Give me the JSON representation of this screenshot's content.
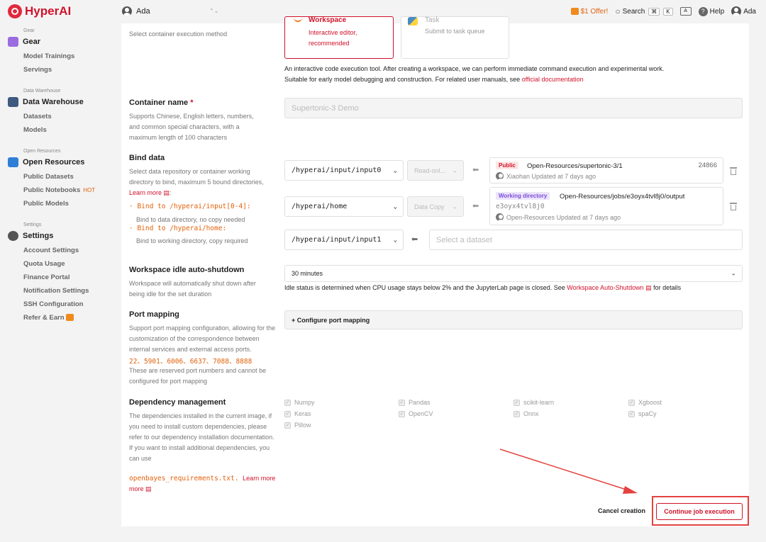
{
  "topbar": {
    "brand": "HyperAI",
    "user": "Ada",
    "offer": "$1 Offer!",
    "search": "Search",
    "kbd_cmd": "⌘",
    "kbd_k": "K",
    "help": "Help",
    "account": "Ada"
  },
  "sidebar": {
    "gear_small": "Gear",
    "gear_title": "Gear",
    "gear_items": [
      "Model Trainings",
      "Servings"
    ],
    "dw_small": "Data Warehouse",
    "dw_title": "Data Warehouse",
    "dw_items": [
      "Datasets",
      "Models"
    ],
    "or_small": "Open Resources",
    "or_title": "Open Resources",
    "or_items": [
      "Public Datasets",
      "Public Notebooks",
      "Public Models"
    ],
    "hot_badge": "HOT",
    "set_small": "Settings",
    "set_title": "Settings",
    "set_items": [
      "Account Settings",
      "Quota Usage",
      "Finance Portal",
      "Notification Settings",
      "SSH Configuration",
      "Refer & Earn"
    ]
  },
  "form": {
    "exec_desc": "Select container execution method",
    "workspace_title": "Workspace",
    "workspace_desc": "Interactive editor, recommended",
    "task_title": "Task",
    "task_desc": "Submit to task queue",
    "exec_info_1": "An interactive code execution tool. After creating a workspace, we can perform immediate command execution and experimental work.",
    "exec_info_2": "Suitable for early model debugging and construction. For related user manuals, see ",
    "exec_info_link": "official documentation",
    "container_label": "Container name",
    "required": "*",
    "container_desc": "Supports Chinese, English letters, numbers, and common special characters, with a maximum length of 100 characters",
    "container_value": "Supertonic-3 Demo",
    "bind_label": "Bind data",
    "bind_desc": "Select data repository or container working directory to bind, maximum 5 bound directories,",
    "learn_more": "Learn more",
    "bind_rule1": "Bind to /hyperai/input[0-4]:",
    "bind_rule1_desc": "Bind to data directory, no copy needed",
    "bind_rule2": "Bind to /hyperai/home:",
    "bind_rule2_desc": "Bind to working directory, copy required",
    "binds": [
      {
        "path": "/hyperai/input/input0",
        "mode": "Read-onl...",
        "badge": "Public",
        "name": "Open-Resources/supertonic-3/1",
        "count": "24866",
        "owner": "Xiaohan",
        "updated": "Updated at 7 days ago"
      },
      {
        "path": "/hyperai/home",
        "mode": "Data Copy",
        "badge": "Working directory",
        "name": "Open-Resources/jobs/e3oyx4tvl8j0/output",
        "id": "e3oyx4tvl8j0",
        "owner": "Open-Resources",
        "updated": "Updated at 7 days ago"
      },
      {
        "path": "/hyperai/input/input1",
        "placeholder": "Select a dataset"
      }
    ],
    "idle_label": "Workspace idle auto-shutdown",
    "idle_desc": "Workspace will automatically shut down after being idle for the set duration",
    "idle_value": "30 minutes",
    "idle_info": "Idle status is determined when CPU usage stays below 2% and the JupyterLab page is closed. See ",
    "idle_link": "Workspace Auto-Shutdown",
    "idle_info_tail": " for details",
    "port_label": "Port mapping",
    "port_desc": "Support port mapping configuration, allowing for the customization of the correspondence between internal services and external access ports.",
    "port_list": "22、5901、6006、6637、7088、8888",
    "port_desc2": "These are reserved port numbers and cannot be configured for port mapping",
    "port_button": "+ Configure port mapping",
    "dep_label": "Dependency management",
    "dep_desc": "The dependencies installed in the current image, if you need to install custom dependencies, please refer to our dependency installation documentation. If you want to install additional dependencies, you can use",
    "dep_file": "openbayes_requirements.txt.",
    "dep_learn": "Learn more",
    "deps": [
      "Numpy",
      "Pandas",
      "scikit-learn",
      "Xgboost",
      "Keras",
      "OpenCV",
      "Onnx",
      "spaCy",
      "Pillow"
    ],
    "cancel": "Cancel creation",
    "continue": "Continue job execution"
  },
  "colors": {
    "accent": "#d0122a",
    "orange": "#e2610b",
    "purple": "#7a4cd8"
  }
}
